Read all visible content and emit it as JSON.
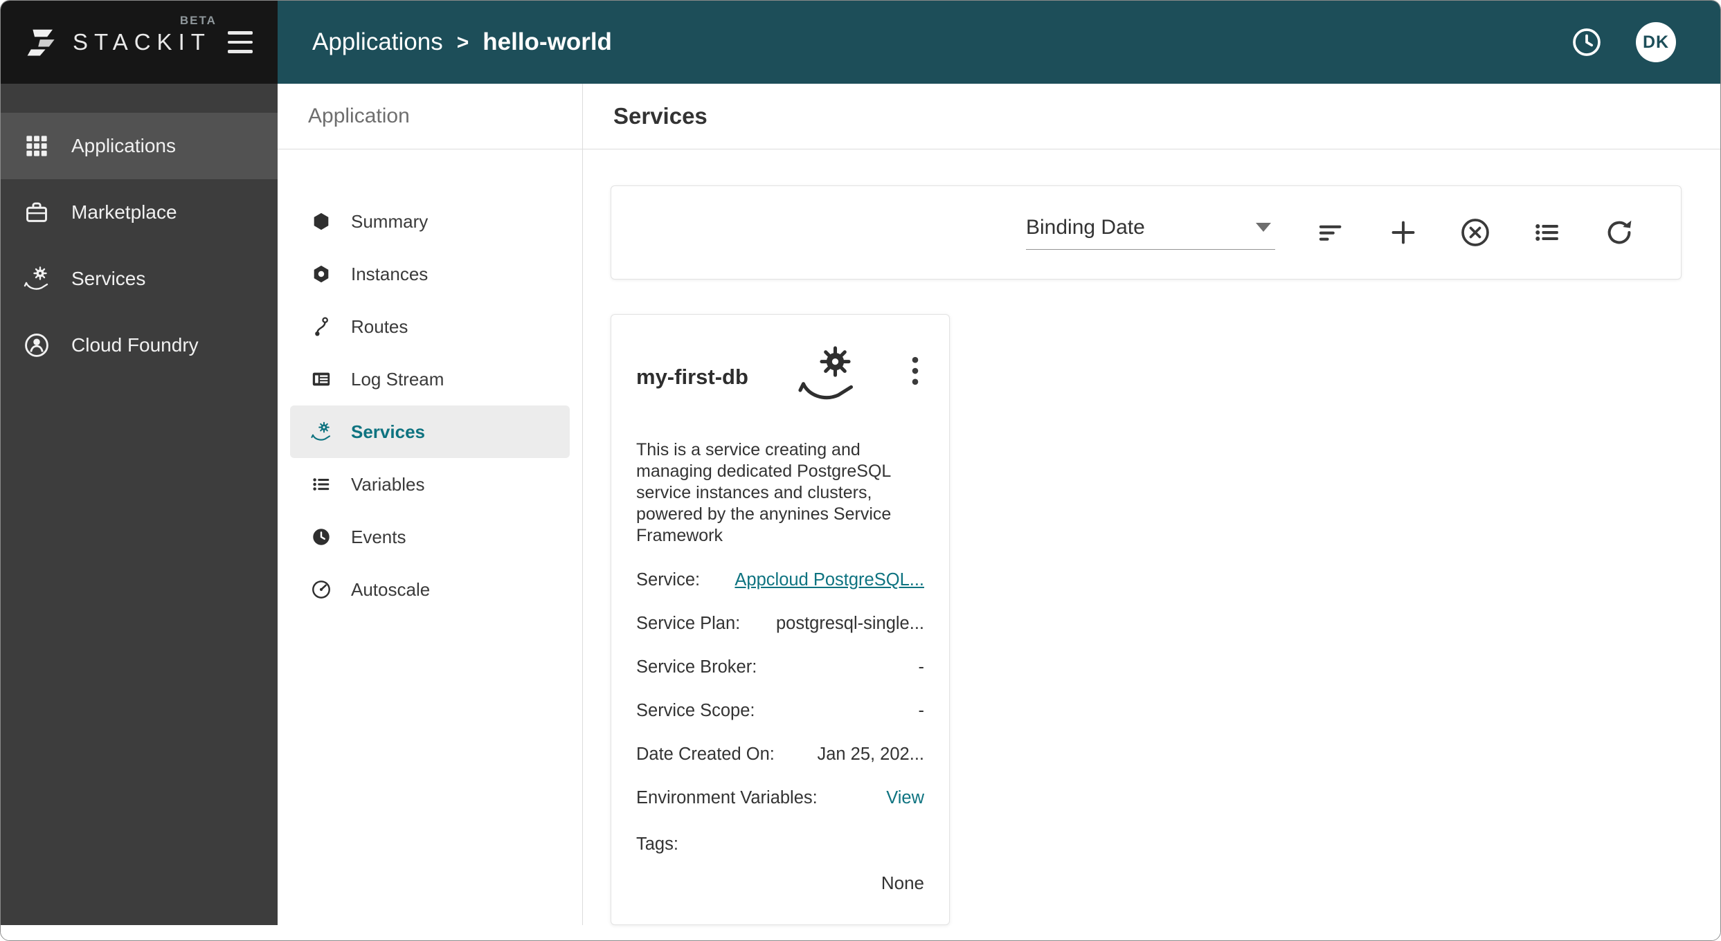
{
  "colors": {
    "header_teal": "#1d4e59",
    "sidebar_dark": "#3d3d3d",
    "accent_teal": "#0e7380",
    "active_sidebar_bg": "#525252",
    "active_subnav_bg": "#ececec"
  },
  "header": {
    "brand": "STACKIT",
    "brand_beta": "BETA",
    "breadcrumb": {
      "section": "Applications",
      "separator": ">",
      "current": "hello-world"
    },
    "avatar_initials": "DK",
    "icons": [
      "hamburger-icon",
      "history-clock-icon"
    ]
  },
  "sidebar": {
    "items": [
      {
        "label": "Applications",
        "icon": "apps-grid-icon",
        "active": true
      },
      {
        "label": "Marketplace",
        "icon": "marketplace-icon",
        "active": false
      },
      {
        "label": "Services",
        "icon": "service-hand-gear-icon",
        "active": false
      },
      {
        "label": "Cloud Foundry",
        "icon": "cloud-foundry-icon",
        "active": false
      }
    ]
  },
  "subnav": {
    "title": "Application",
    "items": [
      {
        "label": "Summary",
        "icon": "hexagon-icon",
        "active": false
      },
      {
        "label": "Instances",
        "icon": "hexagon-dot-icon",
        "active": false
      },
      {
        "label": "Routes",
        "icon": "route-icon",
        "active": false
      },
      {
        "label": "Log Stream",
        "icon": "log-card-icon",
        "active": false
      },
      {
        "label": "Services",
        "icon": "service-hand-gear-icon",
        "active": true
      },
      {
        "label": "Variables",
        "icon": "list-bullets-icon",
        "active": false
      },
      {
        "label": "Events",
        "icon": "clock-icon",
        "active": false
      },
      {
        "label": "Autoscale",
        "icon": "gauge-icon",
        "active": false
      }
    ]
  },
  "main": {
    "title": "Services",
    "toolbar": {
      "sort_select_value": "Binding Date",
      "icons": [
        "sort-lines-icon",
        "plus-icon",
        "circle-x-icon",
        "list-view-icon",
        "refresh-icon"
      ]
    },
    "card": {
      "title": "my-first-db",
      "icon": "service-hand-gear-icon",
      "menu_icon": "kebab-menu-icon",
      "description": "This is a service creating and managing dedicated PostgreSQL service instances and clusters, powered by the anynines Service Framework",
      "fields": [
        {
          "label": "Service:",
          "value": "Appcloud PostgreSQL...",
          "link": true
        },
        {
          "label": "Service Plan:",
          "value": "postgresql-single...",
          "link": false
        },
        {
          "label": "Service Broker:",
          "value": "-",
          "link": false
        },
        {
          "label": "Service Scope:",
          "value": "-",
          "link": false
        },
        {
          "label": "Date Created On:",
          "value": "Jan 25, 202...",
          "link": false
        },
        {
          "label": "Environment Variables:",
          "value": "View",
          "link": true
        }
      ],
      "tags": {
        "label": "Tags:",
        "value": "None"
      }
    }
  }
}
